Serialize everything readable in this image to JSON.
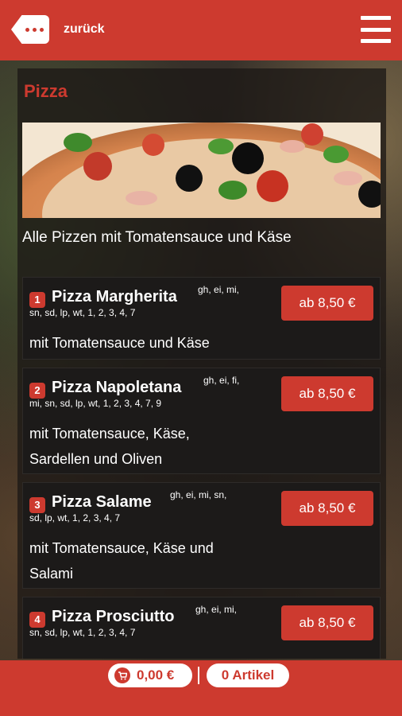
{
  "header": {
    "back_label": "zurück",
    "back_icon": "ellipsis-back-icon",
    "menu_icon": "hamburger-menu-icon"
  },
  "category": {
    "title": "Pizza",
    "intro": "Alle Pizzen mit Tomatensauce und Käse"
  },
  "items": [
    {
      "number": "1",
      "name": "Pizza Margherita",
      "allergens_line1": "gh, ei, mi,",
      "allergens_line2": "sn, sd, lp, wt, 1, 2, 3, 4, 7",
      "description": "mit Tomatensauce und Käse",
      "price": "ab 8,50 €"
    },
    {
      "number": "2",
      "name": "Pizza Napoletana",
      "allergens_line1": "gh, ei, fi,",
      "allergens_line2": "mi, sn, sd, lp, wt, 1, 2, 3, 4, 7, 9",
      "description": "mit Tomatensauce, Käse, Sardellen und Oliven",
      "price": "ab 8,50 €"
    },
    {
      "number": "3",
      "name": "Pizza Salame",
      "allergens_line1": "gh, ei, mi, sn,",
      "allergens_line2": "sd, lp, wt, 1, 2, 3, 4, 7",
      "description": "mit Tomatensauce, Käse und Salami",
      "price": "ab 8,50 €"
    },
    {
      "number": "4",
      "name": "Pizza Prosciutto",
      "allergens_line1": "gh, ei, mi,",
      "allergens_line2": "sn, sd, lp, wt, 1, 2, 3, 4, 7",
      "description": "",
      "price": "ab 8,50 €"
    }
  ],
  "cart": {
    "total": "0,00 €",
    "count": "0 Artikel",
    "cart_icon": "shopping-cart-icon"
  },
  "colors": {
    "accent": "#cd3a2f",
    "card": "#1c1a19",
    "text": "#ffffff"
  }
}
